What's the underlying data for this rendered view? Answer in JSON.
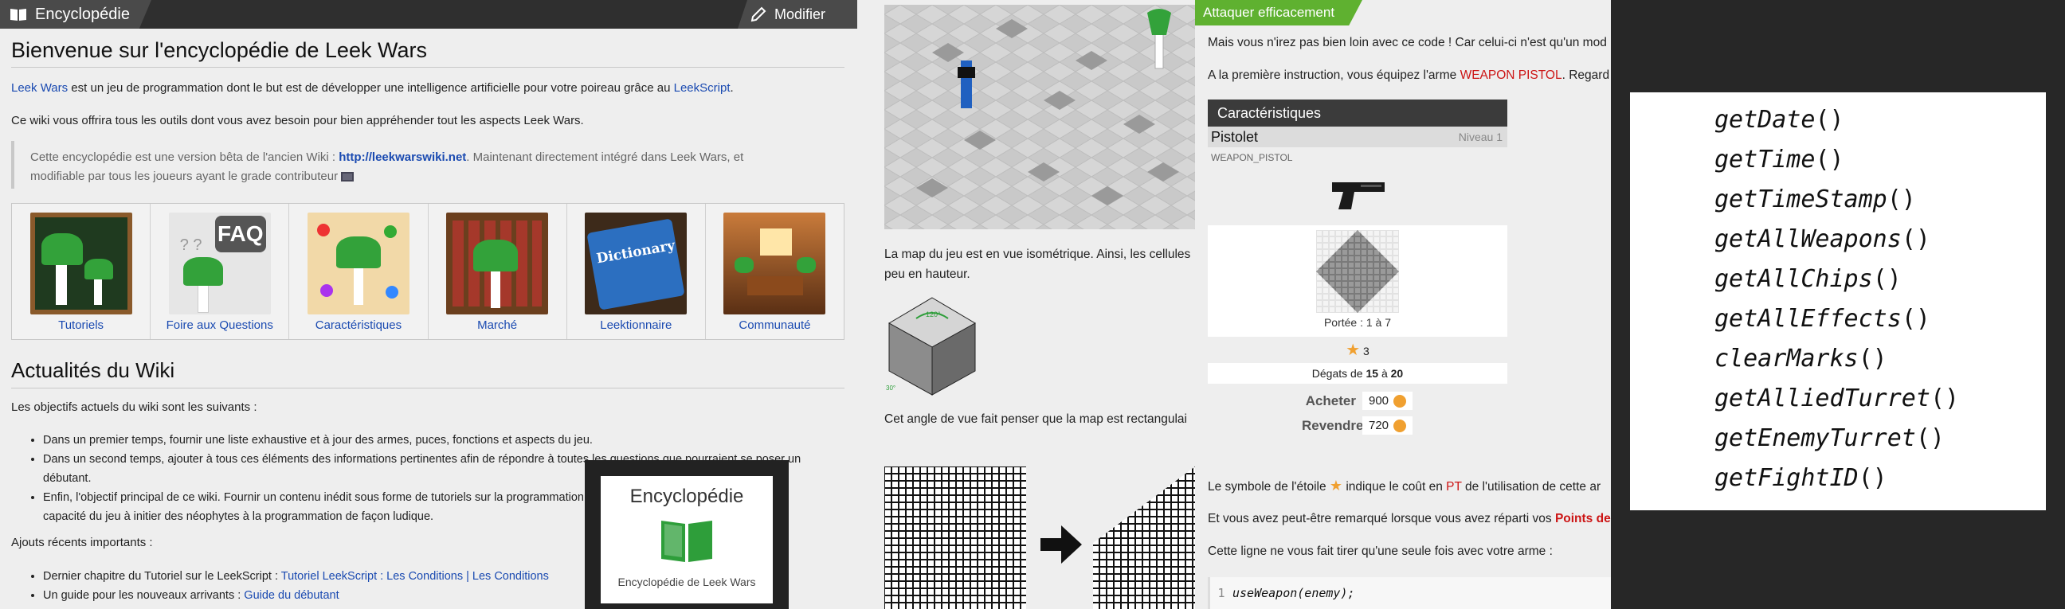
{
  "encyclopedia": {
    "header_title": "Encyclopédie",
    "edit_label": "Modifier",
    "page_title": "Bienvenue sur l'encyclopédie de Leek Wars",
    "intro": {
      "link1": "Leek Wars",
      "text1": " est un jeu de programmation dont le but est de développer une intelligence artificielle pour votre poireau grâce au ",
      "link2": "LeekScript",
      "text2": "."
    },
    "intro2": "Ce wiki vous offrira tous les outils dont vous avez besoin pour bien appréhender tout les aspects Leek Wars.",
    "quote": {
      "text1": "Cette encyclopédie est une version bêta de l'ancien Wiki : ",
      "link": "http://leekwarswiki.net",
      "text2": ". Maintenant directement intégré dans Leek Wars, et",
      "line2": "modifiable par tous les joueurs ayant le grade contributeur"
    },
    "categories": [
      {
        "label": "Tutoriels",
        "icon": "chalkboard-leek-icon"
      },
      {
        "label": "Foire aux Questions",
        "icon": "faq-leek-icon",
        "faq": "FAQ"
      },
      {
        "label": "Caractéristiques",
        "icon": "characteristics-leek-icon"
      },
      {
        "label": "Marché",
        "icon": "market-shelf-icon"
      },
      {
        "label": "Leektionnaire",
        "icon": "dictionary-book-icon",
        "book": "Dictionary"
      },
      {
        "label": "Communauté",
        "icon": "community-room-icon"
      }
    ],
    "news_title": "Actualités du Wiki",
    "objectives_intro": "Les objectifs actuels du wiki sont les suivants :",
    "objectives": [
      "Dans un premier temps, fournir une liste exhaustive et à jour des armes, puces, fonctions et aspects du jeu.",
      "Dans un second temps, ajouter à tous ces éléments des informations pertinentes afin de répondre à toutes les questions que pourraient se poser un",
      "débutant.",
      "Enfin, l'objectif principal de ce wiki. Fournir un contenu inédit sous forme de tutoriels sur la programmation et ainsi renforcer la",
      "capacité du jeu à initier des néophytes à la programmation de façon ludique."
    ],
    "recent_title": "Ajouts récents importants :",
    "recent": [
      {
        "text": "Dernier chapitre du Tutoriel sur le LeekScript : ",
        "link": "Tutoriel LeekScript : Les Conditions | Les Conditions"
      },
      {
        "text": "Un guide pour les nouveaux arrivants : ",
        "link": "Guide du débutant"
      }
    ],
    "card": {
      "title": "Encyclopédie",
      "subtitle": "Encyclopédie de Leek Wars"
    }
  },
  "tutorial": {
    "map_caption_1": "La map du jeu est en vue isométrique. Ainsi, les cellules",
    "map_caption_2": "peu en hauteur.",
    "cube_angle_top": "120°",
    "cube_angle_bottom": "30°",
    "rect_caption": "Cet angle de vue fait penser que la map est rectangulai",
    "section_badge": "Attaquer efficacement",
    "p1": "Mais vous n'irez pas bien loin avec ce code ! Car celui-ci n'est qu'un mod",
    "p2_text": "A la première instruction, vous équipez l'arme ",
    "p2_red": "WEAPON PISTOL",
    "p2_end": ". Regard",
    "weapon": {
      "header": "Caractéristiques",
      "name": "Pistolet",
      "level": "Niveau 1",
      "code": "WEAPON_PISTOL",
      "range": "Portée : 1 à 7",
      "cost": "3",
      "damage_text": "Dégats de ",
      "damage_min": "15",
      "damage_mid": " à ",
      "damage_max": "20",
      "buy_label": "Acheter",
      "buy_price": "900",
      "sell_label": "Revendre",
      "sell_price": "720"
    },
    "p3_a": "Le symbole de l'étoile",
    "p3_b": " indique le coût en ",
    "p3_pt": "PT",
    "p3_c": " de l'utilisation de cette ar",
    "p4_a": "Et vous avez peut-être remarqué lorsque vous avez réparti vos ",
    "p4_red": "Points de",
    "p5": "Cette ligne ne vous fait tirer qu'une seule fois avec votre arme :",
    "code_line_no": "1",
    "code": "useWeapon(enemy);"
  },
  "functions": [
    {
      "name": "getDate",
      "parens": "()"
    },
    {
      "name": "getTime",
      "parens": "()"
    },
    {
      "name": "getTimeStamp",
      "parens": "()"
    },
    {
      "name": "getAllWeapons",
      "parens": "()"
    },
    {
      "name": "getAllChips",
      "parens": "()"
    },
    {
      "name": "getAllEffects",
      "parens": "()"
    },
    {
      "name": "clearMarks",
      "parens": "()"
    },
    {
      "name": "getAlliedTurret",
      "parens": "()"
    },
    {
      "name": "getEnemyTurret",
      "parens": "()"
    },
    {
      "name": "getFightID",
      "parens": "()"
    }
  ],
  "colors": {
    "link": "#1a4ab1",
    "green_badge": "#5fb130",
    "red_text": "#cc1414",
    "dark_header": "#2f2f2f"
  }
}
